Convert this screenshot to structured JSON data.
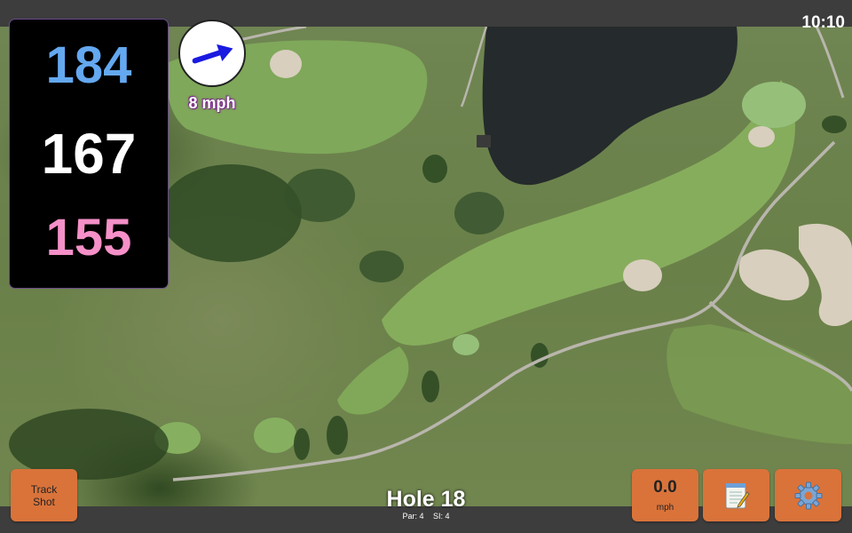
{
  "status": {
    "time": "10:10"
  },
  "distances": {
    "back": "184",
    "middle": "167",
    "front": "155"
  },
  "wind": {
    "speed": "8 mph",
    "direction_icon": "arrow-icon"
  },
  "hole": {
    "title": "Hole 18",
    "par": "Par: 4",
    "stroke_index": "SI: 4"
  },
  "buttons": {
    "track_shot_line1": "Track",
    "track_shot_line2": "Shot",
    "speed_value": "0.0",
    "speed_unit": "mph",
    "notes_icon": "notepad-icon",
    "settings_icon": "gear-icon"
  },
  "colors": {
    "back_distance": "#64a8f0",
    "middle_distance": "#ffffff",
    "front_distance": "#f590c8",
    "button": "#d9733a"
  }
}
